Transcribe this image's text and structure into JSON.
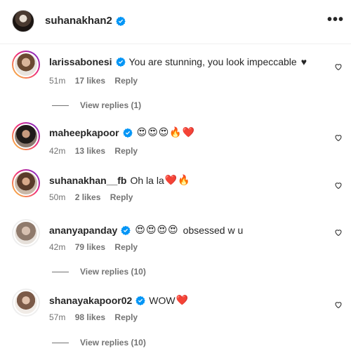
{
  "post": {
    "username": "suhanakhan2",
    "more_label": "•••"
  },
  "comments": [
    {
      "username": "larissabonesi",
      "verified": true,
      "text": "You are stunning, you look impeccable",
      "emojis": "♥",
      "time": "51m",
      "likes": "17 likes",
      "reply_label": "Reply",
      "view_replies": "View replies (1)"
    },
    {
      "username": "maheepkapoor",
      "verified": true,
      "text": "",
      "emojis": "😍😍😍🔥❤️",
      "time": "42m",
      "likes": "13 likes",
      "reply_label": "Reply",
      "view_replies": ""
    },
    {
      "username": "suhanakhan__fb",
      "verified": false,
      "text": "Oh la la",
      "emojis": "❤️🔥",
      "time": "50m",
      "likes": "2 likes",
      "reply_label": "Reply",
      "view_replies": ""
    },
    {
      "username": "ananyapanday",
      "verified": true,
      "text": "obsessed w u",
      "emojis": "😍😍😍😍",
      "time": "42m",
      "likes": "79 likes",
      "reply_label": "Reply",
      "view_replies": "View replies (10)"
    },
    {
      "username": "shanayakapoor02",
      "verified": true,
      "text": "WOW",
      "emojis": "❤️",
      "time": "57m",
      "likes": "98 likes",
      "reply_label": "Reply",
      "view_replies": "View replies (10)"
    }
  ],
  "colors": {
    "verified": "#0095f6",
    "meta": "#737373",
    "text": "#262626"
  }
}
